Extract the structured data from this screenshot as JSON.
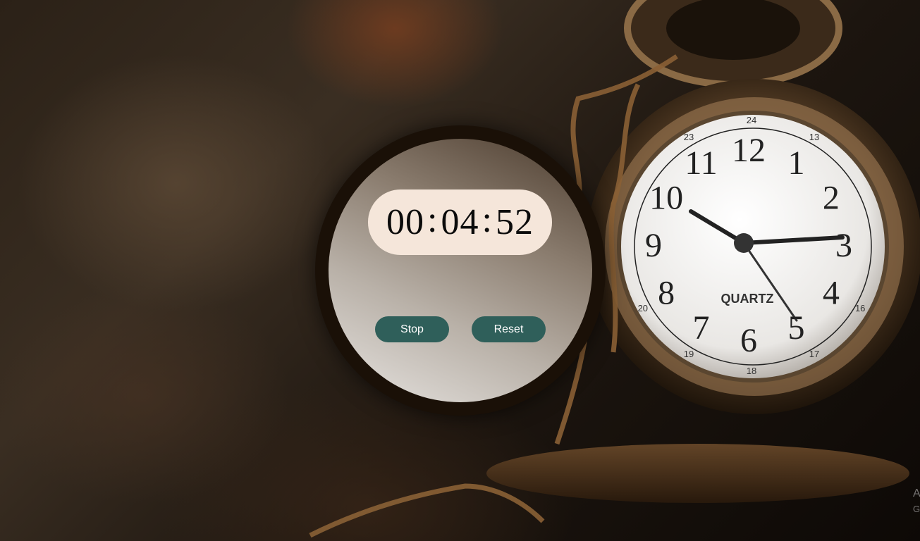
{
  "timer": {
    "hours": "00",
    "minutes": "04",
    "seconds": "52",
    "separator": ":"
  },
  "controls": {
    "stop_label": "Stop",
    "reset_label": "Reset"
  },
  "background": {
    "watch": {
      "brand": "QUARTZ",
      "numerals": [
        "12",
        "1",
        "2",
        "3",
        "4",
        "5",
        "6",
        "7",
        "8",
        "9",
        "10",
        "11"
      ],
      "inner_numerals": [
        "24",
        "13",
        "16",
        "17",
        "18",
        "19",
        "20",
        "23"
      ]
    }
  },
  "overlay": {
    "line1": "A",
    "line2": "G"
  },
  "colors": {
    "button_bg": "#2f5f5a",
    "display_bg": "#f5e6da",
    "ring": "#1a1007"
  }
}
